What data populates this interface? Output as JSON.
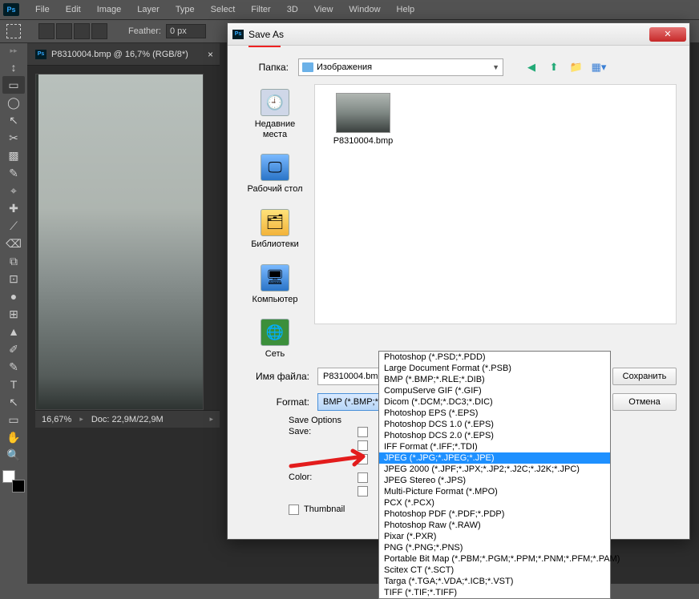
{
  "menu": {
    "items": [
      "File",
      "Edit",
      "Image",
      "Layer",
      "Type",
      "Select",
      "Filter",
      "3D",
      "View",
      "Window",
      "Help"
    ]
  },
  "options": {
    "feather_label": "Feather:",
    "feather_value": "0 px"
  },
  "document": {
    "tab_title": "P8310004.bmp @ 16,7% (RGB/8*)",
    "zoom": "16,67%",
    "doc_info": "Doc: 22,9M/22,9M"
  },
  "dialog": {
    "title": "Save As",
    "folder_label": "Папка:",
    "folder_value": "Изображения",
    "places": {
      "recent": "Недавние\nместа",
      "desktop": "Рабочий стол",
      "libraries": "Библиотеки",
      "computer": "Компьютер",
      "network": "Сеть"
    },
    "file_label": "P8310004.bmp",
    "filename_label": "Имя файла:",
    "filename_value": "P8310004.bmp",
    "format_label": "Format:",
    "format_value": "BMP (*.BMP;*.RLE;*.DIB)",
    "save_btn": "Сохранить",
    "cancel_btn": "Отмена",
    "save_options_title": "Save Options",
    "save_sub": "Save:",
    "color_sub": "Color:",
    "thumbnail_label": "Thumbnail"
  },
  "dropdown": {
    "items": [
      "Photoshop (*.PSD;*.PDD)",
      "Large Document Format (*.PSB)",
      "BMP (*.BMP;*.RLE;*.DIB)",
      "CompuServe GIF (*.GIF)",
      "Dicom (*.DCM;*.DC3;*.DIC)",
      "Photoshop EPS (*.EPS)",
      "Photoshop DCS 1.0 (*.EPS)",
      "Photoshop DCS 2.0 (*.EPS)",
      "IFF Format (*.IFF;*.TDI)",
      "JPEG (*.JPG;*.JPEG;*.JPE)",
      "JPEG 2000 (*.JPF;*.JPX;*.JP2;*.J2C;*.J2K;*.JPC)",
      "JPEG Stereo (*.JPS)",
      "Multi-Picture Format (*.MPO)",
      "PCX (*.PCX)",
      "Photoshop PDF (*.PDF;*.PDP)",
      "Photoshop Raw (*.RAW)",
      "Pixar (*.PXR)",
      "PNG (*.PNG;*.PNS)",
      "Portable Bit Map (*.PBM;*.PGM;*.PPM;*.PNM;*.PFM;*.PAM)",
      "Scitex CT (*.SCT)",
      "Targa (*.TGA;*.VDA;*.ICB;*.VST)",
      "TIFF (*.TIF;*.TIFF)"
    ],
    "selected_index": 9
  },
  "tools": [
    "↕",
    "▭",
    "◯",
    "↖",
    "✂",
    "▩",
    "✎",
    "⌖",
    "✚",
    "⟋",
    "⌫",
    "⧉",
    "⊡",
    "●",
    "⊞",
    "▲",
    "✐",
    "✎",
    "T",
    "↖",
    "▭",
    "✋",
    "🔍"
  ]
}
